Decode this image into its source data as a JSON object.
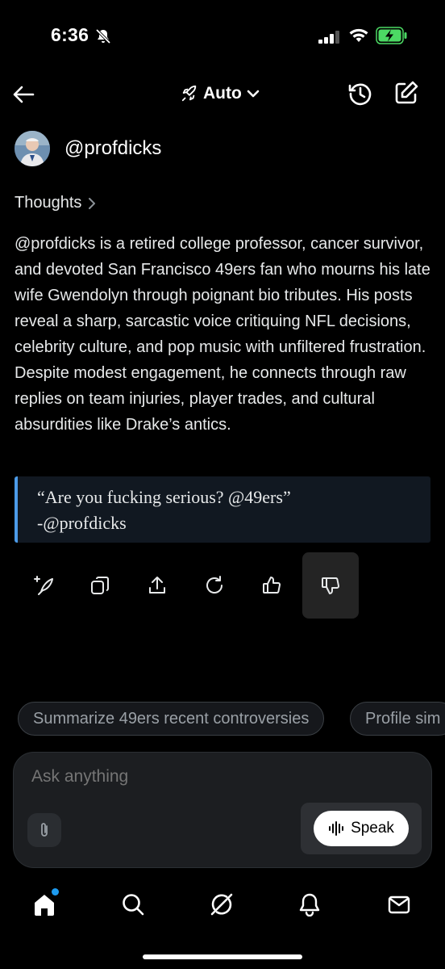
{
  "status_bar": {
    "time": "6:36"
  },
  "header": {
    "mode_label": "Auto"
  },
  "profile": {
    "handle": "@profdicks"
  },
  "thoughts": {
    "label": "Thoughts"
  },
  "summary": {
    "text": "@profdicks is a retired college professor, cancer survivor, and devoted San Francisco 49ers fan who mourns his late wife Gwendolyn through poignant bio tributes. His posts reveal a sharp, sarcastic voice critiquing NFL decisions, celebrity culture, and pop music with unfiltered frustration. Despite modest engagement, he connects through raw replies on team injuries, player trades, and cultural absurdities like Drake’s antics."
  },
  "quote": {
    "line1": "“Are you fucking serious? @49ers”",
    "line2": "-@profdicks"
  },
  "actions": [
    {
      "name": "regenerate-sparkle-icon"
    },
    {
      "name": "copy-icon"
    },
    {
      "name": "share-icon"
    },
    {
      "name": "refresh-icon"
    },
    {
      "name": "thumbs-up-icon"
    },
    {
      "name": "thumbs-down-icon",
      "active": true
    }
  ],
  "suggestions": [
    "Summarize 49ers recent controversies",
    "Profile sim"
  ],
  "composer": {
    "placeholder": "Ask anything",
    "speak_label": "Speak"
  },
  "tabbar": {
    "items": [
      "home",
      "search",
      "grok",
      "notifications",
      "messages"
    ],
    "accent": "#1d9bf0"
  }
}
